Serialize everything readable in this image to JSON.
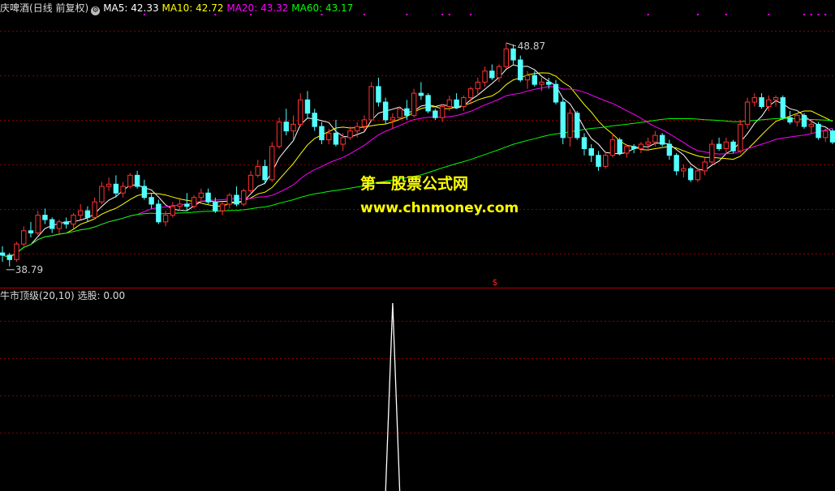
{
  "main_panel": {
    "stock_name": "庆啤酒",
    "period": "(日线 前复权)",
    "ma": [
      {
        "label": "MA5:",
        "value": "42.33",
        "color": "#ffffff"
      },
      {
        "label": "MA10:",
        "value": "42.72",
        "color": "#ffff00"
      },
      {
        "label": "MA20:",
        "value": "43.32",
        "color": "#ff00ff"
      },
      {
        "label": "MA60:",
        "value": "43.17",
        "color": "#00ff00"
      }
    ],
    "high_label": "48.87",
    "low_label": "38.79",
    "marker": "$"
  },
  "sub_panel": {
    "indicator": "牛市顶级(20,10)",
    "output_label": "选股:",
    "output_value": "0.00"
  },
  "watermark": {
    "line1": "第一股票公式网",
    "line2": "www.chnmoney.com"
  },
  "colors": {
    "up": "#ff3232",
    "down": "#54ffff",
    "grid": "#8b0000",
    "divider": "#b00000"
  },
  "chart_data": [
    {
      "type": "candlestick",
      "title": "",
      "price_range": [
        38.2,
        50.0
      ],
      "y_markers": {
        "high": 48.87,
        "low": 38.79
      },
      "candles": [
        [
          39.4,
          39.7,
          39.0,
          39.3
        ],
        [
          39.3,
          39.4,
          38.79,
          39.1
        ],
        [
          39.1,
          39.9,
          39.0,
          39.8
        ],
        [
          39.8,
          40.6,
          39.7,
          40.4
        ],
        [
          40.4,
          40.8,
          40.1,
          40.3
        ],
        [
          40.3,
          41.3,
          40.2,
          41.1
        ],
        [
          41.1,
          41.4,
          40.7,
          40.9
        ],
        [
          40.9,
          41.0,
          40.3,
          40.5
        ],
        [
          40.5,
          40.9,
          40.2,
          40.8
        ],
        [
          40.8,
          41.0,
          40.5,
          40.7
        ],
        [
          40.7,
          41.2,
          40.5,
          41.1
        ],
        [
          41.1,
          41.6,
          40.9,
          41.3
        ],
        [
          41.3,
          41.5,
          40.8,
          41.0
        ],
        [
          41.0,
          41.9,
          40.9,
          41.7
        ],
        [
          41.7,
          42.6,
          41.6,
          42.4
        ],
        [
          42.4,
          42.8,
          42.2,
          42.5
        ],
        [
          42.5,
          42.9,
          41.9,
          42.1
        ],
        [
          42.1,
          42.6,
          41.9,
          42.4
        ],
        [
          42.4,
          43.0,
          42.3,
          42.9
        ],
        [
          42.9,
          43.1,
          42.3,
          42.4
        ],
        [
          42.4,
          42.7,
          41.8,
          41.9
        ],
        [
          41.9,
          42.1,
          41.4,
          41.6
        ],
        [
          41.6,
          41.8,
          40.7,
          40.8
        ],
        [
          40.8,
          41.3,
          40.6,
          41.1
        ],
        [
          41.1,
          41.7,
          41.0,
          41.5
        ],
        [
          41.5,
          41.9,
          41.3,
          41.6
        ],
        [
          41.6,
          42.1,
          41.3,
          41.5
        ],
        [
          41.5,
          42.0,
          41.4,
          41.9
        ],
        [
          41.9,
          42.3,
          41.7,
          42.1
        ],
        [
          42.1,
          42.3,
          41.6,
          41.7
        ],
        [
          41.7,
          41.9,
          41.2,
          41.3
        ],
        [
          41.3,
          41.7,
          41.1,
          41.6
        ],
        [
          41.6,
          42.1,
          41.4,
          42.0
        ],
        [
          42.0,
          42.4,
          41.5,
          41.6
        ],
        [
          41.6,
          42.3,
          41.5,
          42.2
        ],
        [
          42.2,
          43.1,
          42.1,
          42.9
        ],
        [
          42.9,
          43.6,
          42.8,
          43.3
        ],
        [
          43.3,
          43.6,
          42.5,
          42.7
        ],
        [
          42.7,
          44.4,
          42.6,
          44.2
        ],
        [
          44.2,
          45.5,
          44.1,
          45.3
        ],
        [
          45.3,
          45.9,
          44.7,
          44.9
        ],
        [
          44.9,
          45.6,
          44.5,
          45.2
        ],
        [
          45.2,
          46.6,
          45.1,
          46.3
        ],
        [
          46.3,
          46.7,
          45.5,
          45.7
        ],
        [
          45.7,
          45.9,
          44.9,
          45.1
        ],
        [
          45.1,
          45.3,
          44.3,
          44.5
        ],
        [
          44.5,
          45.0,
          44.3,
          44.8
        ],
        [
          44.8,
          45.4,
          44.2,
          44.3
        ],
        [
          44.3,
          44.8,
          44.0,
          44.6
        ],
        [
          44.6,
          45.1,
          44.5,
          44.9
        ],
        [
          44.9,
          45.3,
          44.6,
          45.1
        ],
        [
          45.1,
          45.6,
          44.9,
          45.4
        ],
        [
          45.4,
          47.1,
          45.3,
          46.9
        ],
        [
          46.9,
          47.3,
          46.0,
          46.2
        ],
        [
          46.2,
          46.4,
          45.2,
          45.4
        ],
        [
          45.4,
          45.7,
          45.0,
          45.5
        ],
        [
          45.5,
          46.0,
          45.4,
          45.9
        ],
        [
          45.9,
          46.3,
          45.4,
          45.6
        ],
        [
          45.6,
          46.8,
          45.5,
          46.6
        ],
        [
          46.6,
          47.1,
          46.3,
          46.5
        ],
        [
          46.5,
          46.6,
          45.7,
          45.8
        ],
        [
          45.8,
          45.9,
          45.4,
          45.5
        ],
        [
          45.5,
          46.1,
          45.3,
          46.0
        ],
        [
          46.0,
          46.5,
          45.8,
          46.3
        ],
        [
          46.3,
          46.6,
          45.9,
          46.0
        ],
        [
          46.0,
          46.5,
          45.8,
          46.4
        ],
        [
          46.4,
          46.9,
          46.1,
          46.8
        ],
        [
          46.8,
          47.3,
          46.5,
          47.1
        ],
        [
          47.1,
          47.8,
          46.9,
          47.6
        ],
        [
          47.6,
          47.9,
          47.2,
          47.3
        ],
        [
          47.3,
          47.9,
          47.1,
          47.8
        ],
        [
          47.8,
          48.87,
          47.7,
          48.6
        ],
        [
          48.6,
          48.8,
          47.9,
          48.1
        ],
        [
          48.1,
          48.3,
          47.1,
          47.2
        ],
        [
          47.2,
          47.6,
          46.8,
          47.4
        ],
        [
          47.4,
          47.6,
          46.9,
          47.0
        ],
        [
          47.0,
          47.3,
          46.7,
          47.1
        ],
        [
          47.1,
          47.3,
          46.8,
          47.0
        ],
        [
          47.0,
          47.2,
          46.1,
          46.2
        ],
        [
          46.2,
          46.4,
          44.3,
          44.6
        ],
        [
          44.6,
          45.9,
          44.2,
          45.7
        ],
        [
          45.7,
          45.8,
          44.5,
          44.6
        ],
        [
          44.6,
          44.8,
          43.8,
          44.1
        ],
        [
          44.1,
          44.3,
          43.5,
          43.8
        ],
        [
          43.8,
          44.0,
          43.1,
          43.3
        ],
        [
          43.3,
          44.0,
          43.2,
          43.8
        ],
        [
          43.8,
          44.8,
          43.7,
          44.5
        ],
        [
          44.5,
          44.6,
          43.8,
          43.9
        ],
        [
          43.9,
          44.3,
          43.7,
          44.2
        ],
        [
          44.2,
          44.3,
          43.9,
          44.1
        ],
        [
          44.1,
          44.4,
          43.9,
          44.3
        ],
        [
          44.3,
          44.6,
          44.0,
          44.4
        ],
        [
          44.4,
          44.9,
          44.2,
          44.7
        ],
        [
          44.7,
          44.8,
          44.2,
          44.3
        ],
        [
          44.3,
          44.5,
          43.6,
          43.8
        ],
        [
          43.8,
          43.9,
          42.9,
          43.1
        ],
        [
          43.1,
          43.4,
          42.8,
          43.2
        ],
        [
          43.2,
          43.3,
          42.6,
          42.7
        ],
        [
          42.7,
          43.2,
          42.6,
          43.1
        ],
        [
          43.1,
          43.7,
          42.9,
          43.5
        ],
        [
          43.5,
          44.5,
          43.4,
          44.3
        ],
        [
          44.3,
          44.6,
          44.0,
          44.1
        ],
        [
          44.1,
          44.6,
          43.9,
          44.4
        ],
        [
          44.4,
          44.5,
          43.9,
          44.0
        ],
        [
          44.0,
          45.4,
          43.9,
          45.2
        ],
        [
          45.2,
          46.4,
          45.0,
          46.2
        ],
        [
          46.2,
          46.6,
          46.0,
          46.4
        ],
        [
          46.4,
          46.6,
          45.9,
          46.0
        ],
        [
          46.0,
          46.5,
          45.8,
          46.3
        ],
        [
          46.3,
          46.5,
          46.0,
          46.4
        ],
        [
          46.4,
          46.5,
          45.4,
          45.5
        ],
        [
          45.5,
          45.8,
          45.2,
          45.3
        ],
        [
          45.3,
          45.7,
          45.1,
          45.6
        ],
        [
          45.6,
          45.7,
          45.0,
          45.1
        ],
        [
          45.1,
          45.4,
          44.8,
          45.2
        ],
        [
          45.2,
          45.3,
          44.5,
          44.6
        ],
        [
          44.6,
          45.0,
          44.4,
          44.9
        ],
        [
          44.9,
          45.0,
          44.3,
          44.4
        ]
      ],
      "moving_averages": [
        {
          "name": "MA5",
          "period": 5,
          "color": "#ffffff",
          "last_value": 42.33
        },
        {
          "name": "MA10",
          "period": 10,
          "color": "#ffff00",
          "last_value": 42.72
        },
        {
          "name": "MA20",
          "period": 20,
          "color": "#ff00ff",
          "last_value": 43.32
        },
        {
          "name": "MA60",
          "period": 60,
          "color": "#00ff00",
          "last_value": 43.17
        }
      ],
      "signal_dots": [
        20,
        30,
        35,
        45,
        51,
        57,
        62,
        63,
        66,
        91,
        98,
        102,
        108,
        113,
        114,
        115,
        116,
        118
      ]
    },
    {
      "type": "line",
      "title": "牛市顶级(20,10)",
      "series": [
        {
          "name": "选股",
          "color": "#ffffff",
          "ylim": [
            0,
            1
          ],
          "points": [
            [
              54,
              0
            ],
            [
              55,
              1
            ],
            [
              56,
              0
            ]
          ]
        }
      ]
    }
  ]
}
